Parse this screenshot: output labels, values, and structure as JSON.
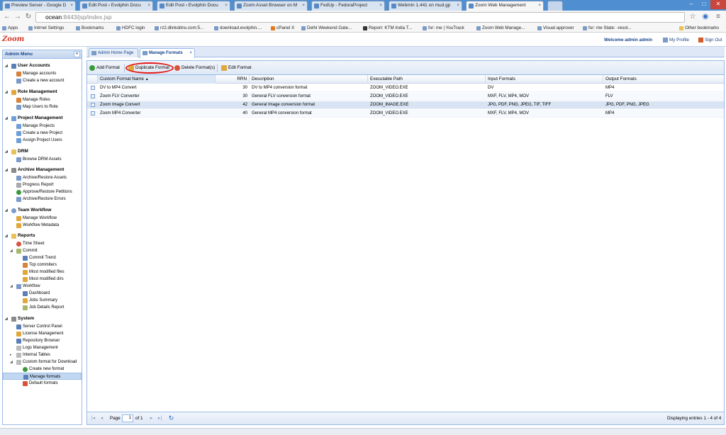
{
  "browser": {
    "tabs": [
      {
        "title": "Preview Server - Google D",
        "active": false
      },
      {
        "title": "Edit Post ‹ Evolphin Docu",
        "active": false
      },
      {
        "title": "Edit Post ‹ Evolphin Docu",
        "active": false
      },
      {
        "title": "Zoom Asset Browser on M",
        "active": false
      },
      {
        "title": "FedUp - FedoraProject",
        "active": false
      },
      {
        "title": "Webmin 1.441 on mud.gp",
        "active": false
      },
      {
        "title": "Zoom Web Management",
        "active": true
      }
    ],
    "url_host": "ocean",
    "url_rest": ":8443/jsp/index.jsp",
    "bookmarks": [
      "Apps",
      "Intrnet Settings",
      "Bookmarks",
      "HDFC login",
      "rz2.dlinkddns.com:5...",
      "download.evolphin....",
      "cPanel X",
      "Delhi Weekend Gate...",
      "Report: KTM India T...",
      "for: me | YouTrack",
      "Zoom Web Manage...",
      "Visual approver",
      "for: me State: -resol..."
    ],
    "other_bookmarks": "Other bookmarks"
  },
  "header": {
    "logo": "Zoom",
    "welcome": "Welcome admin admin",
    "my_profile": "My Profile",
    "sign_out": "Sign Out"
  },
  "sidebar": {
    "title": "Admin Menu",
    "collapse": "«",
    "groups": [
      {
        "label": "User Accounts",
        "items": [
          "Manage accounts",
          "Create a new account"
        ]
      },
      {
        "label": "Role Management",
        "items": [
          "Manage Roles",
          "Map Users to Role"
        ]
      },
      {
        "label": "Project Management",
        "items": [
          "Manage Projects",
          "Create a new Project",
          "Assign Project Users"
        ]
      },
      {
        "label": "DRM",
        "items": [
          "Browse DRM Assets"
        ]
      },
      {
        "label": "Archive Management",
        "items": [
          "Archive/Restore Assets",
          "Progress Report",
          "Approve/Restore Petitions",
          "Archive/Restore Errors"
        ]
      },
      {
        "label": "Team Workflow",
        "items": [
          "Manage Workflow",
          "Workflow Metadata"
        ]
      },
      {
        "label": "Reports",
        "items": [
          "Time Sheet",
          "Commit",
          "Commit Trend",
          "Top commiters",
          "Most modified files",
          "Most modified dirs",
          "Workflow",
          "Dashboard",
          "Jobs Summary",
          "Job Details Report"
        ]
      },
      {
        "label": "System",
        "items": [
          "Server Control Panel",
          "License Management",
          "Repository Browser",
          "Logs Management",
          "Internal Tables",
          "Custom format for Download",
          "Create new format",
          "Manage formats",
          "Default formats"
        ]
      }
    ]
  },
  "panel_tabs": [
    {
      "label": "Admin Home Page",
      "active": false
    },
    {
      "label": "Manage Formats",
      "active": true,
      "close": "×"
    }
  ],
  "toolbar": {
    "add": "Add Format",
    "duplicate": "Duplicate Format",
    "delete": "Delete Format(s)",
    "edit": "Edit Format"
  },
  "grid": {
    "columns": [
      "Custom Format Name",
      "RRN",
      "Description",
      "Executable Path",
      "Input Formats",
      "Output Formats"
    ],
    "sort_indicator": "▲",
    "rows": [
      {
        "name": "DV to MP4 Convert",
        "rrn": "30",
        "description": "DV to MP4 conversion format",
        "exe": "ZOOM_VIDEO.EXE",
        "input": "DV",
        "output": "MP4"
      },
      {
        "name": "Zoom FLV Converter",
        "rrn": "30",
        "description": "General FLV conversion format",
        "exe": "ZOOM_VIDEO.EXE",
        "input": "MXF, FLV, MP4, MOV",
        "output": "FLV"
      },
      {
        "name": "Zoom Image Convert",
        "rrn": "42",
        "description": "General Image conversion format",
        "exe": "ZOOM_IMAGE.EXE",
        "input": "JPG, PDF, PNG, JPEG, TIF, TIFF",
        "output": "JPG, PDF, PNG, JPEG"
      },
      {
        "name": "Zoom MP4 Converter",
        "rrn": "40",
        "description": "General MP4 conversion format",
        "exe": "ZOOM_VIDEO.EXE",
        "input": "MXF, FLV, MP4, MOV",
        "output": "MP4"
      }
    ]
  },
  "pager": {
    "page_label": "Page",
    "page_value": "1",
    "of_label": "of 1",
    "display": "Displaying entries 1 - 4 of 4"
  },
  "colors": {
    "accent": "#15428b",
    "highlight": "#e01a1a",
    "border": "#99bbe8"
  }
}
